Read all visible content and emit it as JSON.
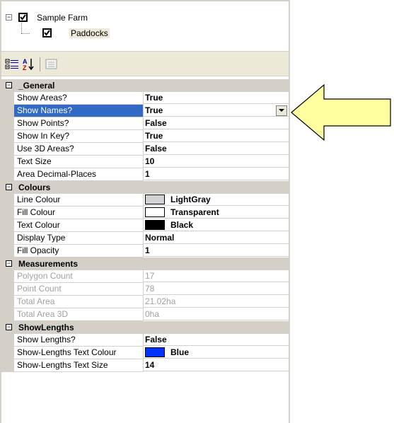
{
  "tree": {
    "root_label": "Sample Farm",
    "child_label": "Paddocks",
    "expander_symbol": "−"
  },
  "toolbar": {
    "categorized_icon": "categorized-icon",
    "alphabetical_icon": "alphabetical-sort-icon",
    "property_pages_icon": "property-pages-icon"
  },
  "grid": {
    "categories": [
      {
        "label": "_General",
        "rows": [
          {
            "name": "Show Areas?",
            "value": "True"
          },
          {
            "name": "Show Names?",
            "value": "True",
            "selected": true
          },
          {
            "name": "Show Points?",
            "value": "False"
          },
          {
            "name": "Show In Key?",
            "value": "True"
          },
          {
            "name": "Use 3D Areas?",
            "value": "False"
          },
          {
            "name": "Text Size",
            "value": "10"
          },
          {
            "name": "Area Decimal-Places",
            "value": "1"
          }
        ]
      },
      {
        "label": "Colours",
        "rows": [
          {
            "name": "Line Colour",
            "value": "LightGray",
            "swatch": "#d3d3d3"
          },
          {
            "name": "Fill Colour",
            "value": "Transparent",
            "swatch": "#ffffff"
          },
          {
            "name": "Text Colour",
            "value": "Black",
            "swatch": "#000000"
          },
          {
            "name": "Display Type",
            "value": "Normal"
          },
          {
            "name": "Fill Opacity",
            "value": "1"
          }
        ]
      },
      {
        "label": "Measurements",
        "rows": [
          {
            "name": "Polygon Count",
            "value": "17",
            "disabled": true
          },
          {
            "name": "Point Count",
            "value": "78",
            "disabled": true
          },
          {
            "name": "Total Area",
            "value": "21.02ha",
            "disabled": true
          },
          {
            "name": "Total Area 3D",
            "value": "0ha",
            "disabled": true
          }
        ]
      },
      {
        "label": "ShowLengths",
        "rows": [
          {
            "name": "Show Lengths?",
            "value": "False"
          },
          {
            "name": "Show-Lengths Text Colour",
            "value": "Blue",
            "swatch": "#0033ff"
          },
          {
            "name": "Show-Lengths Text Size",
            "value": "14"
          }
        ]
      }
    ]
  },
  "colors": {
    "selection": "#316ac5",
    "category_bg": "#d4d0c8",
    "callout_fill": "#ffffa0"
  }
}
